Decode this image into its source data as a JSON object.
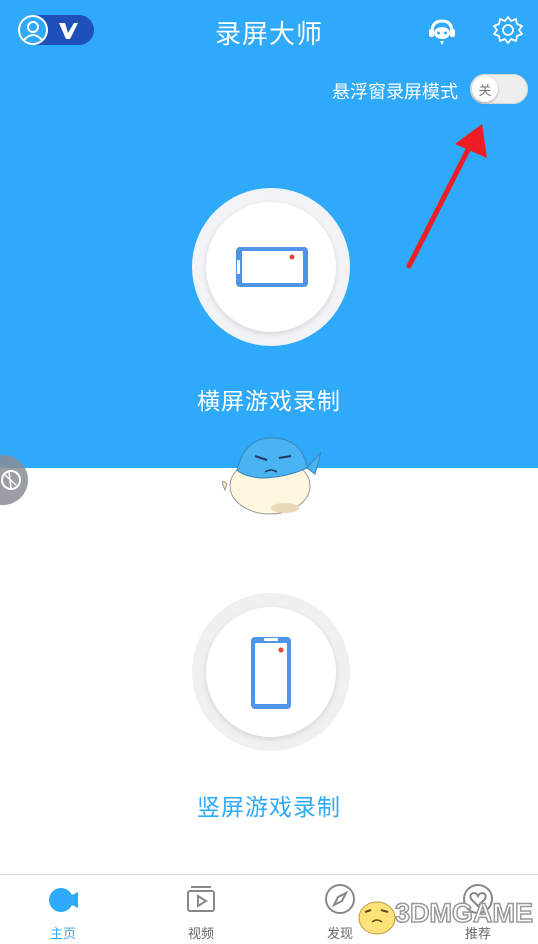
{
  "header": {
    "title": "录屏大师",
    "vip_badge": "V",
    "support_icon": "customer-service-icon",
    "settings_icon": "gear-icon"
  },
  "float_mode": {
    "label": "悬浮窗录屏模式",
    "toggle_text": "关",
    "enabled": false
  },
  "modes": {
    "landscape_label": "横屏游戏录制",
    "portrait_label": "竖屏游戏录制"
  },
  "nav": {
    "items": [
      {
        "label": "主页",
        "icon": "camera-icon",
        "active": true
      },
      {
        "label": "视频",
        "icon": "play-icon",
        "active": false
      },
      {
        "label": "发现",
        "icon": "compass-icon",
        "active": false
      },
      {
        "label": "推荐",
        "icon": "heart-icon",
        "active": false
      }
    ]
  },
  "watermark": {
    "text": "3DMGAME"
  },
  "colors": {
    "primary": "#2fa9fa",
    "vip_pill": "#1f4fb8",
    "arrow": "#ee1c25"
  }
}
